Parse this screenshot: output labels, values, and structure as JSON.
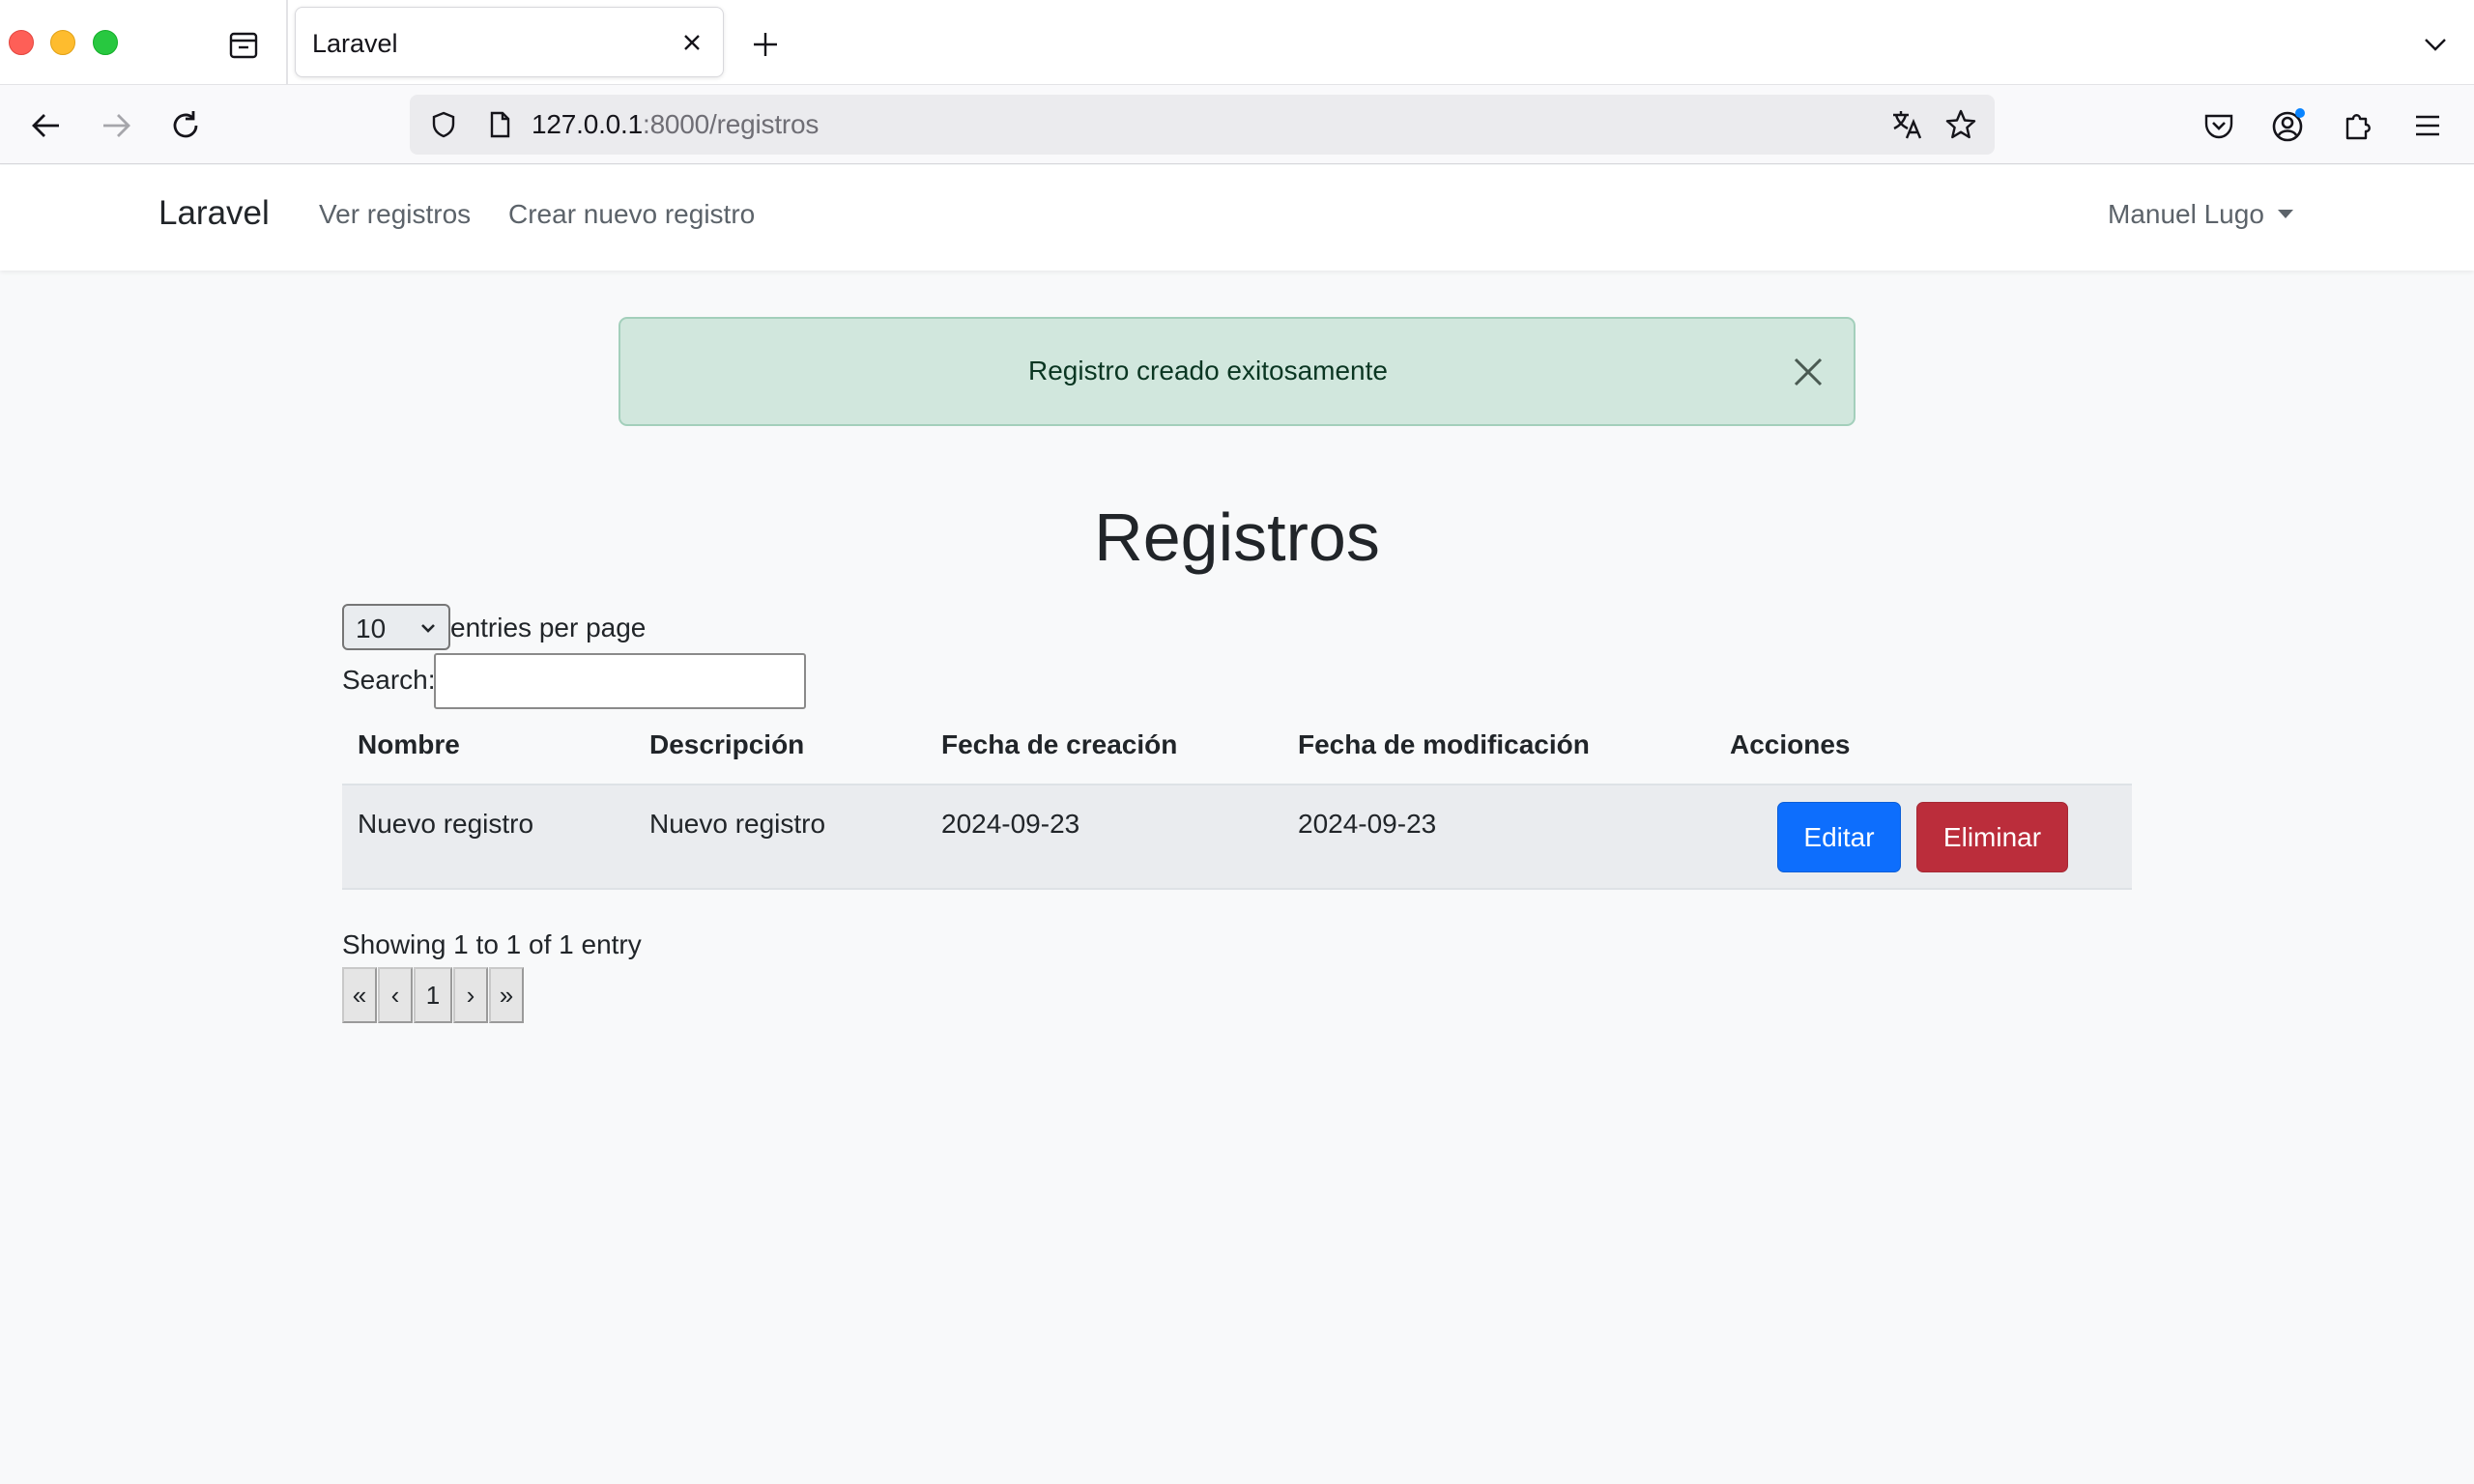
{
  "browser": {
    "tab_title": "Laravel",
    "url_host": "127.0.0.1",
    "url_rest": ":8000/registros"
  },
  "app_nav": {
    "brand": "Laravel",
    "links": [
      "Ver registros",
      "Crear nuevo registro"
    ],
    "user": "Manuel Lugo"
  },
  "alert": {
    "message": "Registro creado exitosamente",
    "color": "#d1e7dd"
  },
  "page": {
    "title": "Registros"
  },
  "datatable": {
    "per_page_value": "10",
    "per_page_label": "entries per page",
    "search_label": "Search:",
    "search_value": "",
    "columns": [
      "Nombre",
      "Descripción",
      "Fecha de creación",
      "Fecha de modificación",
      "Acciones"
    ],
    "rows": [
      {
        "nombre": "Nuevo registro",
        "descripcion": "Nuevo registro",
        "fecha_creacion": "2024-09-23",
        "fecha_modificacion": "2024-09-23",
        "edit_label": "Editar",
        "delete_label": "Eliminar"
      }
    ],
    "info": "Showing 1 to 1 of 1 entry",
    "pagination": {
      "first": "«",
      "prev": "‹",
      "current": "1",
      "next": "›",
      "last": "»"
    }
  },
  "colors": {
    "primary": "#0d6efd",
    "danger": "#bb2d3b",
    "success_bg": "#d1e7dd"
  }
}
